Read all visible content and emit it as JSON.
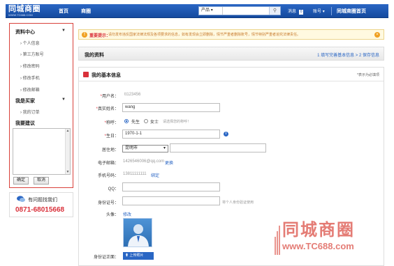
{
  "topbar": {
    "logo_text": "同城商圈",
    "logo_url": "WWW.TC688.COM",
    "nav": [
      "首页",
      "商圈"
    ],
    "search_category": "产品",
    "messages_label": "消息",
    "messages_count": "0",
    "account_label": "账号",
    "home_label": "同城商圈首页"
  },
  "sidebar": {
    "section1_title": "资料中心",
    "section1_items": [
      "个人信息",
      "第三方账号",
      "修改密码",
      "修改手机",
      "修改邮箱"
    ],
    "section2_title": "我是买家",
    "section2_items": [
      "我的订单"
    ],
    "suggest_title": "我要建议",
    "confirm_label": "确定",
    "cancel_label": "取消"
  },
  "contact": {
    "label": "有问题找我们",
    "phone": "0871-68015668"
  },
  "notice": {
    "title": "重要提示：",
    "text": "请勿发布违反国家法律法规及各项要求的信息，如有发现会立即删除，情节严重者删除账号，情节特别严重者追究法律责任。"
  },
  "profile": {
    "title": "我的资料",
    "steps": "1 填写完善基本信息 > 2 保存信息"
  },
  "form": {
    "title": "我的基本信息",
    "required_note": "*表示为必填项",
    "username_label": "用户名：",
    "username_value": "tt123456",
    "realname_label": "真实姓名：",
    "realname_value": "wang",
    "gender_label": "称呼：",
    "gender_options": [
      "先生",
      "女士"
    ],
    "gender_hint": "请选择您的称呼！",
    "birthday_label": "生日：",
    "birthday_value": "1970-1-1",
    "location_label": "居住地：",
    "location_value": "昆明市",
    "email_label": "电子邮箱：",
    "email_value": "1426546006@qq.com",
    "email_change": "更换",
    "phone_label": "手机号码：",
    "phone_value": "13811111111",
    "phone_bind": "绑定",
    "qq_label": "QQ：",
    "idcard_label": "身份证号：",
    "idcard_hint": "将个人身份验证使用",
    "avatar_label": "头像：",
    "avatar_edit": "修改",
    "idfront_label": "身份证正面：",
    "upload_label": "上传照片"
  },
  "watermark": {
    "text": "同城商圈",
    "url": "www.TC688.com"
  },
  "colors": {
    "brand_blue": "#2a66c4",
    "accent_red": "#d9303a",
    "notice_bg": "#fff9e0"
  }
}
